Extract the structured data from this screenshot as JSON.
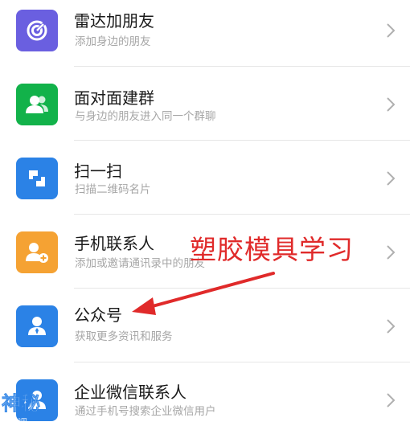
{
  "colors": {
    "radar": "#6a5fe0",
    "group": "#12b24a",
    "scan": "#2b82e6",
    "contacts": "#f5a233",
    "official": "#2b82e6",
    "enterprise": "#2b82e6",
    "overlay_red": "#e02a2a"
  },
  "items": [
    {
      "title": "雷达加朋友",
      "subtitle": "添加身边的朋友",
      "icon": "radar-icon"
    },
    {
      "title": "面对面建群",
      "subtitle": "与身边的朋友进入同一个群聊",
      "icon": "group-people-icon"
    },
    {
      "title": "扫一扫",
      "subtitle": "扫描二维码名片",
      "icon": "scan-icon"
    },
    {
      "title": "手机联系人",
      "subtitle": "添加或邀请通讯录中的朋友",
      "icon": "add-contact-icon"
    },
    {
      "title": "公众号",
      "subtitle": "获取更多资讯和服务",
      "icon": "official-account-icon"
    },
    {
      "title": "企业微信联系人",
      "subtitle": "通过手机号搜索企业微信用户",
      "icon": "enterprise-contact-icon"
    }
  ],
  "overlay": {
    "text": "塑胶模具学习"
  }
}
